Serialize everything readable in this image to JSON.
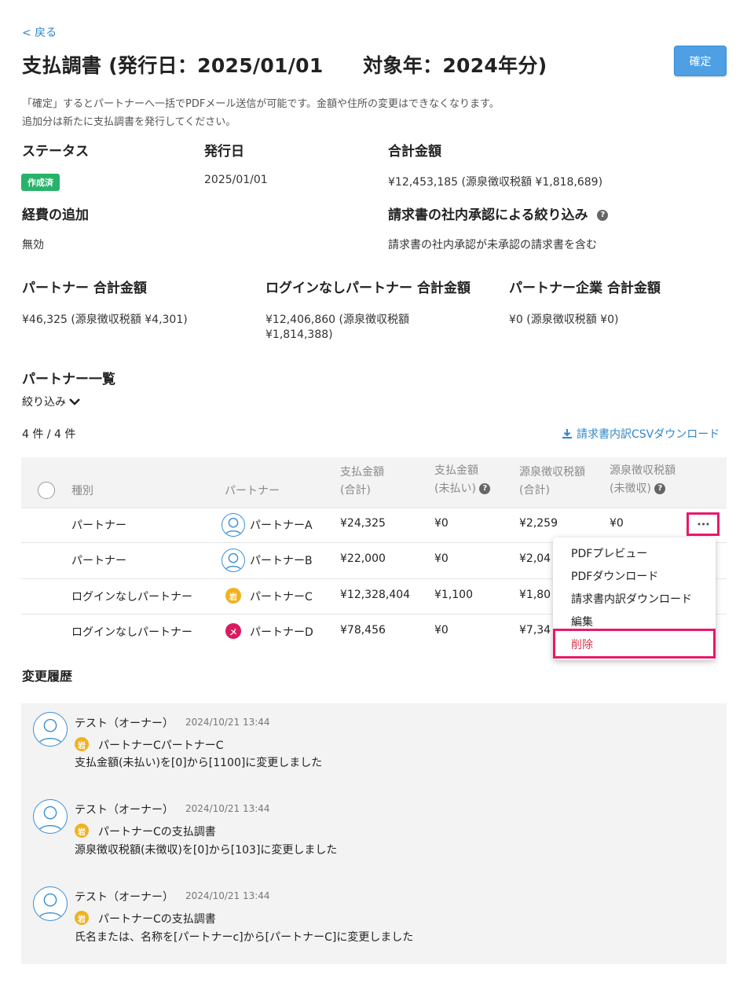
{
  "nav": {
    "back_label": "< 戻る"
  },
  "page": {
    "title": "支払調書 (発行日：2025/01/01　　対象年：2024年分)",
    "confirm_button": "確定",
    "note_line1": "「確定」するとパートナーへ一括でPDFメール送信が可能です。金額や住所の変更はできなくなります。",
    "note_line2": "追加分は新たに支払調書を発行してください。"
  },
  "summary": {
    "status_label": "ステータス",
    "status_value": "作成済",
    "issue_date_label": "発行日",
    "issue_date_value": "2025/01/01",
    "total_label": "合計金額",
    "total_value": "¥12,453,185 (源泉徴収税額 ¥1,818,689)",
    "expense_label": "経費の追加",
    "expense_value": "無効",
    "approval_label": "請求書の社内承認による絞り込み",
    "approval_value": "請求書の社内承認が未承認の請求書を含む",
    "partner_total_label": "パートナー 合計金額",
    "partner_total_value": "¥46,325 (源泉徴収税額 ¥4,301)",
    "nologin_total_label": "ログインなしパートナー 合計金額",
    "nologin_total_value_line1": "¥12,406,860 (源泉徴収税額",
    "nologin_total_value_line2": "¥1,814,388)",
    "company_total_label": "パートナー企業 合計金額",
    "company_total_value": "¥0 (源泉徴収税額 ¥0)"
  },
  "partners": {
    "section_title": "パートナー一覧",
    "filter_label": "絞り込み",
    "count_text": "4 件 / 4 件",
    "csv_download": "請求書内訳CSVダウンロード",
    "columns": {
      "type": "種別",
      "partner": "パートナー",
      "paid_total_1": "支払金額",
      "paid_total_2": "(合計)",
      "unpaid_1": "支払金額",
      "unpaid_2": "(未払い)",
      "withholding_total_1": "源泉徴収税額",
      "withholding_total_2": "(合計)",
      "withholding_unpaid_1": "源泉徴収税額",
      "withholding_unpaid_2": "(未徴収)"
    },
    "rows": [
      {
        "type": "パートナー",
        "name": "パートナーA",
        "avatar": "person-outline",
        "paid": "¥24,325",
        "unpaid": "¥0",
        "withholding": "¥2,259",
        "withholding_unpaid": "¥0"
      },
      {
        "type": "パートナー",
        "name": "パートナーB",
        "avatar": "person-outline",
        "paid": "¥22,000",
        "unpaid": "¥0",
        "withholding": "¥2,04",
        "withholding_unpaid": ""
      },
      {
        "type": "ログインなしパートナー",
        "name": "パートナーC",
        "avatar": "岩",
        "avatar_color": "#f1b21f",
        "paid": "¥12,328,404",
        "unpaid": "¥1,100",
        "withholding": "¥1,80",
        "withholding_unpaid": ""
      },
      {
        "type": "ログインなしパートナー",
        "name": "パートナーD",
        "avatar": "メ",
        "avatar_color": "#d81b60",
        "paid": "¥78,456",
        "unpaid": "¥0",
        "withholding": "¥7,34",
        "withholding_unpaid": ""
      }
    ],
    "row_menu": {
      "more_label": "•••",
      "items": [
        "PDFプレビュー",
        "PDFダウンロード",
        "請求書内訳ダウンロード",
        "編集",
        "削除"
      ]
    }
  },
  "history": {
    "section_title": "変更履歴",
    "entries": [
      {
        "user": "テスト（オーナー）",
        "time": "2024/10/21 13:44",
        "badge": "岩",
        "subject": "パートナーCパートナーC",
        "message": "支払金額(未払い)を[0]から[1100]に変更しました"
      },
      {
        "user": "テスト（オーナー）",
        "time": "2024/10/21 13:44",
        "badge": "岩",
        "subject": "パートナーCの支払調書",
        "message": "源泉徴収税額(未徴収)を[0]から[103]に変更しました"
      },
      {
        "user": "テスト（オーナー）",
        "time": "2024/10/21 13:44",
        "badge": "岩",
        "subject": "パートナーCの支払調書",
        "message": "氏名または、名称を[パートナーc]から[パートナーC]に変更しました"
      }
    ]
  },
  "colors": {
    "accent": "#2f87c9",
    "status_green": "#27b36a",
    "highlight": "#e8196a",
    "delete_text": "#d6364e"
  }
}
